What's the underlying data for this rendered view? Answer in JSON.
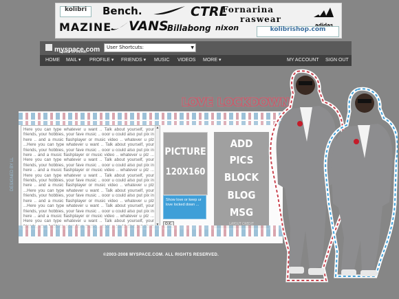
{
  "banner": {
    "brands": [
      "kolibri",
      "Bench.",
      "CTRL",
      "Fornarina",
      "raswear",
      "adidas",
      "MAZINE",
      "VANS",
      "Billabong",
      "nixon",
      "kolibrishop.com"
    ],
    "shop_url": "kolibrishop.com"
  },
  "myspace": {
    "logo": "myspace.com",
    "tagline": "a place for friends",
    "shortcuts_label": "User Shortcuts:"
  },
  "nav": {
    "home": "HOME",
    "mail": "MAIL ▾",
    "profile": "PROFILE ▾",
    "friends": "FRIENDS ▾",
    "music": "MUSIC",
    "videos": "VIDEOS",
    "more": "MORE ▾",
    "account": "MY ACCOUNT",
    "signout": "SIGN OUT"
  },
  "title": "LOVE LOCKDOWN",
  "profile": {
    "bio": "Here you can type whatever u want .. Talk about yourself, your friends, your hobbies, your fave music .. ooor u could also put pix in here .. and a music flashplayer or music video .. whatever u plz ...Here you can type whatever u want .. Talk about yourself, your friends, your hobbies, your fave music .. ooor u could also put pix in here .. and a music flashplayer or music video .. whatever u plz ... Here you can type whatever u want .. Talk about yourself, your friends, your hobbies, your fave music .. ooor u could also put pix in here .. and a music flashplayer or music video .. whatever u plz ... Here you can type whatever u want .. Talk about yourself, your friends, your hobbies, your fave music .. ooor u could also put pix in here .. and a music flashplayer or music video .. whatever u plz ...Here you can type whatever u want .. Talk about yourself, your friends, your hobbies, your fave music .. ooor u could also put pix in here .. and a music flashplayer or music video .. whatever u plz ...Here you can type whatever u want .. Talk about yourself, your friends, your hobbies, your fave music .. ooor u could also put pix in here .. and a music flashplayer or music video .. whatever u plz ... Here you can type whatever u want .. Talk about yourself, your friends, your hobbies, your fave music .. ooor u could also put pix in here .. and a music flashplayer or music video .. whatever u plz ...",
    "vertical_label": "DESIGNED BY LL",
    "picture_line1": "PICTURE",
    "picture_line2": "120X160",
    "lock_text": "Show love or keep ur love locked down ...",
    "ok_label": "O.K.",
    "add_words": [
      "ADD",
      "PICS",
      "BLOCK",
      "BLOG",
      "MSG"
    ],
    "layout_credit": "LAYOUT CREDIT"
  },
  "footer": "©2003-2008 MYSPACE.COM. ALL RIGHTS RESERVED.",
  "colors": {
    "background": "#868686",
    "nav": "#3f3f3f",
    "title_outline": "#c85a6a",
    "accent_blue": "#3f9fd8",
    "stripe_blue": "#9cc1d8",
    "stripe_pink": "#d9a5ae"
  }
}
